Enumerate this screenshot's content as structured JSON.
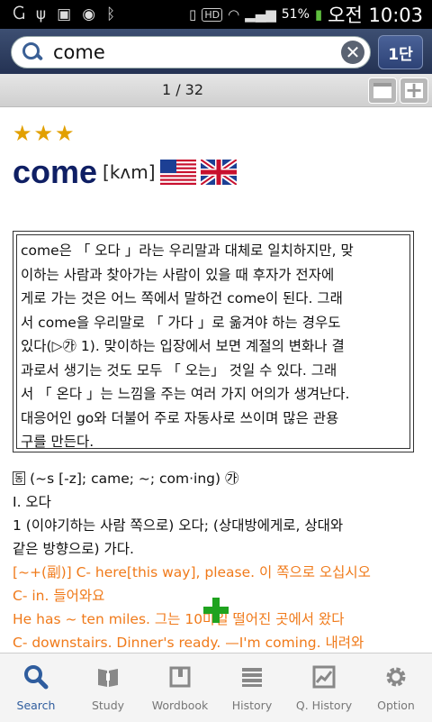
{
  "status_bar": {
    "icons": [
      "menu-g-icon",
      "usb-icon",
      "image-icon",
      "eye-icon",
      "bluetooth-icon",
      "vibrate-icon",
      "hd-icon",
      "wifi-icon",
      "signal-icon"
    ],
    "battery": "51%",
    "time": "오전 10:03"
  },
  "search": {
    "query": "come",
    "level_button": "1단"
  },
  "pager": {
    "text": "1 / 32"
  },
  "entry": {
    "stars": "★★★",
    "headword": "come",
    "pronunciation": "[kʌm]",
    "usage_note": [
      "come은 「 오다 」라는 우리말과 대체로 일치하지만, 맞",
      "이하는 사람과 찾아가는 사람이 있을 때 후자가 전자에",
      "게로 가는 것은 어느 쪽에서 말하건 come이 된다. 그래",
      "서 come을 우리말로 「 가다 」로 옮겨야 하는 경우도",
      "있다(▷㉮ 1). 맞이하는 입장에서 보면 계절의 변화나 결",
      "과로서 생기는 것도 모두 「 오는」 것일 수 있다. 그래",
      "서 「 온다 」는 느낌을 주는 여러 가지 어의가 생겨난다.",
      "대응어인 go와 더불어 주로 자동사로 쓰이며 많은 관용",
      "구를 만든다."
    ],
    "pos_label": "동",
    "inflection": "(~s [-z]; came; ~; com·ing) ㉮",
    "sense_header": "Ⅰ. 오다",
    "sense_1_line1": "1 (이야기하는 사람 쪽으로) 오다; (상대방에게로, 상대와",
    "sense_1_line2": "같은 방향으로) 가다.",
    "examples": [
      "[~+(副)] C- here[this way], please. 이 쪽으로 오십시오",
      "C- in. 들어와요",
      "He has ~ ten miles. 그는 10마일 떨어진 곳에서 왔다",
      "C- downstairs. Dinner's ready. —I'm coming. 내려와"
    ]
  },
  "bottom_nav": [
    {
      "label": "Search",
      "icon": "search-icon"
    },
    {
      "label": "Study",
      "icon": "book-icon"
    },
    {
      "label": "Wordbook",
      "icon": "wordbook-icon"
    },
    {
      "label": "History",
      "icon": "history-icon"
    },
    {
      "label": "Q. History",
      "icon": "chart-icon"
    },
    {
      "label": "Option",
      "icon": "gear-icon"
    }
  ],
  "colors": {
    "accent": "#2f5d9e",
    "example": "#f07a1a",
    "headword": "#0f1f64",
    "stars": "#e2a000"
  }
}
